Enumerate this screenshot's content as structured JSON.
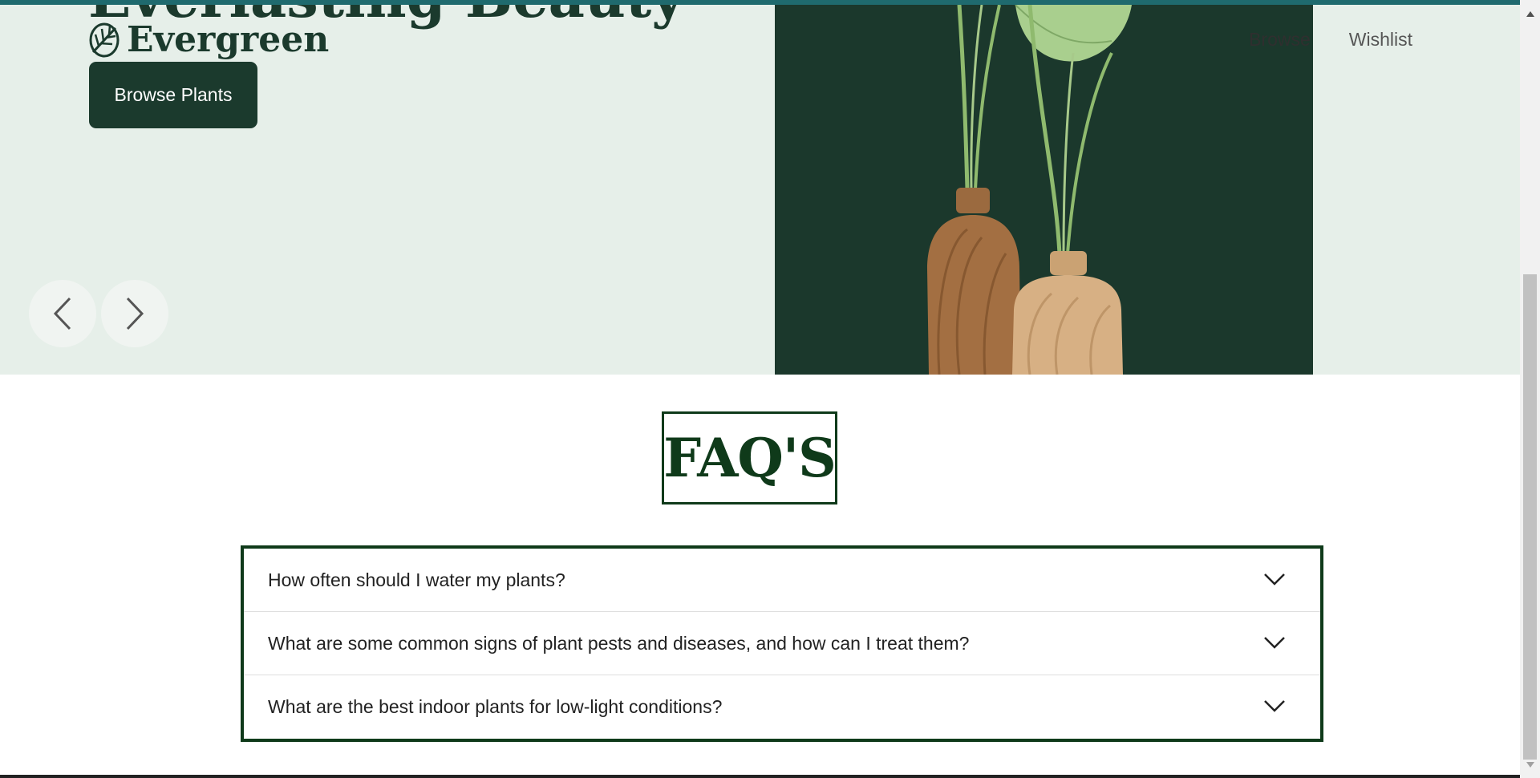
{
  "hero": {
    "heading": "Everlasting Beauty",
    "brand_name": "Evergreen",
    "cta_label": "Browse Plants",
    "nav": {
      "browse_label": "Browse",
      "wishlist_label": "Wishlist"
    },
    "prev_icon": "chevron-left-icon",
    "next_icon": "chevron-right-icon",
    "logo_icon": "leaf-icon"
  },
  "faq": {
    "title": "FAQ'S",
    "items": [
      {
        "question": "How often should I water my plants?"
      },
      {
        "question": "What are some common signs of plant pests and diseases, and how can I treat them?"
      },
      {
        "question": "What are the best indoor plants for low-light conditions?"
      }
    ],
    "expand_icon": "chevron-down-icon"
  },
  "colors": {
    "brand_dark": "#1b3a2d",
    "hero_background": "#e6efe9",
    "faq_border": "#0f3a1a",
    "top_accent": "#1f6a6e"
  }
}
